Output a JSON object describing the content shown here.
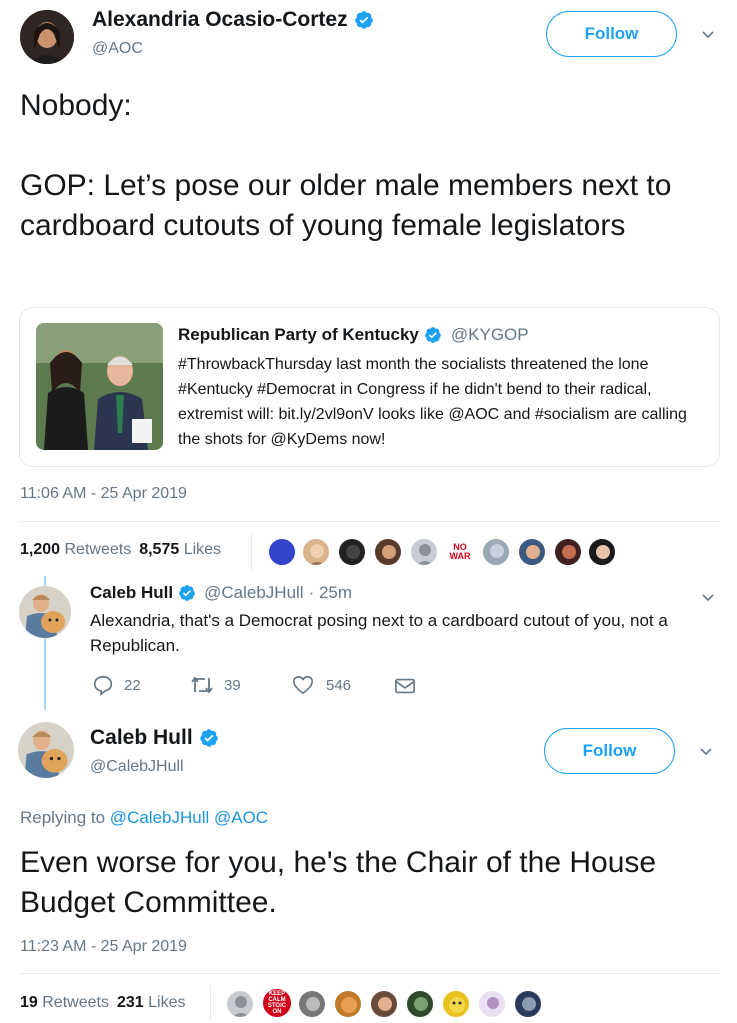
{
  "tweet1": {
    "name": "Alexandria Ocasio-Cortez",
    "handle": "@AOC",
    "follow_label": "Follow",
    "text_line1": "Nobody:",
    "text_para2": "GOP: Let’s pose our older male members next to cardboard cutouts of young female legislators",
    "timestamp": "11:06 AM - 25 Apr 2019",
    "retweets_num": "1,200",
    "retweets_label": "Retweets",
    "likes_num": "8,575",
    "likes_label": "Likes"
  },
  "quote": {
    "name": "Republican Party of Kentucky",
    "handle": "@KYGOP",
    "text": "#ThrowbackThursday last month the socialists threatened the lone #Kentucky #Democrat in Congress if he didn't bend to their radical, extremist will: bit.ly/2vl9onV looks like @AOC and #socialism are calling the shots for @KyDems now!"
  },
  "reply": {
    "name": "Caleb Hull",
    "handle": "@CalebJHull",
    "time": "· 25m",
    "text": "Alexandria, that's a Democrat posing next to a cardboard cutout of you, not a Republican.",
    "replies": "22",
    "retweets": "39",
    "likes": "546"
  },
  "tweet2": {
    "name": "Caleb Hull",
    "handle": "@CalebJHull",
    "follow_label": "Follow",
    "replying_prefix": "Replying to",
    "replying_users": "@CalebJHull @AOC",
    "text": "Even worse for you, he's the Chair of the House Budget Committee.",
    "timestamp": "11:23 AM - 25 Apr 2019",
    "retweets_num": "19",
    "retweets_label": "Retweets",
    "likes_num": "231",
    "likes_label": "Likes"
  },
  "badges": {
    "no_war": "NO WAR",
    "keep_calm": "KEEP CALM STOIC ON"
  },
  "colors": {
    "accent": "#1da1f2",
    "link": "#1b95e0",
    "muted": "#657786",
    "divider": "#e6ecf0"
  }
}
